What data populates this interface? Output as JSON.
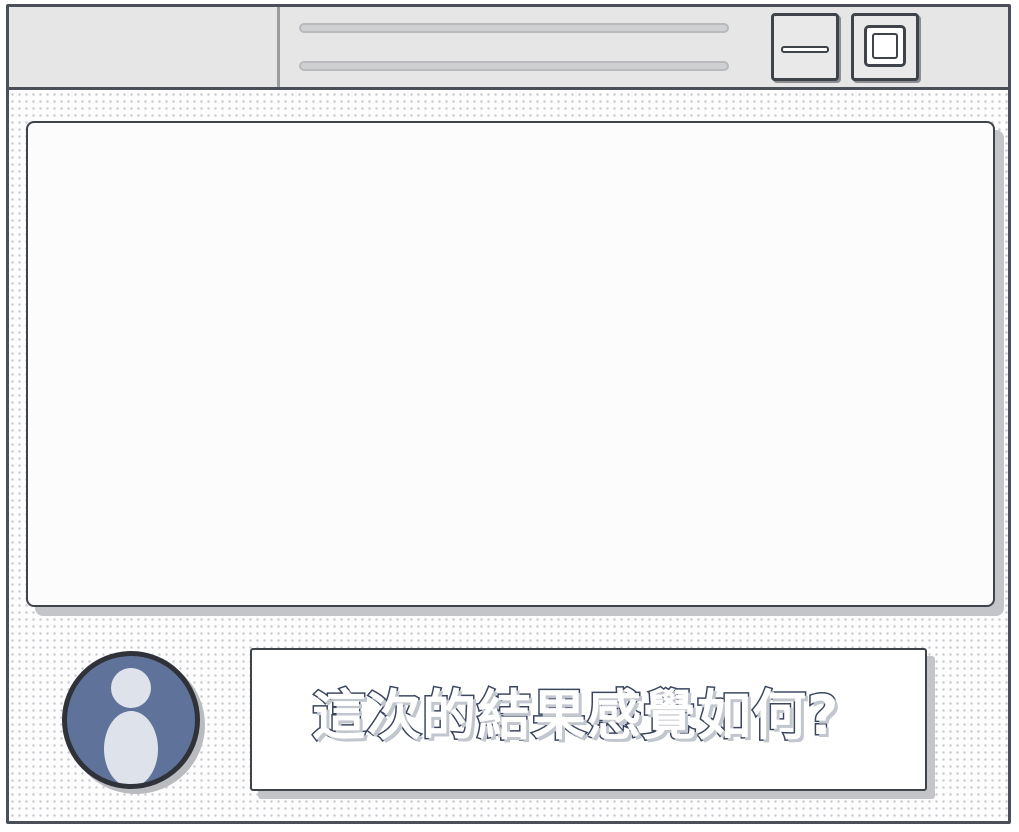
{
  "window": {
    "title_lines": 2,
    "controls": {
      "minimize_icon": "minimize-icon",
      "maximize_icon": "maximize-icon"
    }
  },
  "dialog": {
    "text": "這次的結果感覺如何?"
  },
  "avatar": {
    "icon": "user-silhouette-icon",
    "color": "#5f7299"
  },
  "colors": {
    "border": "#3f434a",
    "titlebar": "#e6e6e7",
    "avatar_bg": "#5f7299",
    "text_outline": "#3b465e"
  }
}
